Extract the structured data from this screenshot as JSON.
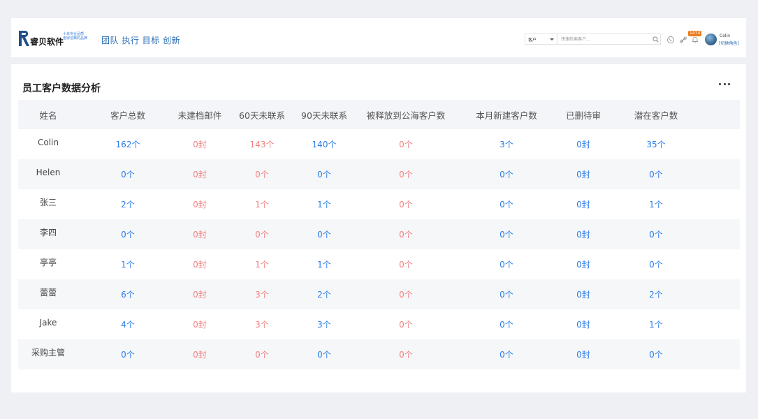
{
  "header": {
    "logo_name": "睿贝软件",
    "logo_tagline_1": "十年专业品质",
    "logo_tagline_2": "值得信赖的品牌",
    "slogan": "团队 执行 目标 创新",
    "search": {
      "type_label": "客户",
      "placeholder": "快速检索客户..."
    },
    "notification_count": "1474",
    "user": {
      "name": "Colin",
      "switch_role": "[切换角色]"
    }
  },
  "panel": {
    "title": "员工客户数据分析",
    "columns": [
      "姓名",
      "客户总数",
      "未建档邮件",
      "60天未联系",
      "90天未联系",
      "被释放到公海客户数",
      "本月新建客户数",
      "已删待审",
      "潜在客户数"
    ],
    "rows": [
      [
        "Colin",
        "162个",
        "0封",
        "143个",
        "140个",
        "0个",
        "3个",
        "0封",
        "35个"
      ],
      [
        "Helen",
        "0个",
        "0封",
        "0个",
        "0个",
        "0个",
        "0个",
        "0封",
        "0个"
      ],
      [
        "张三",
        "2个",
        "0封",
        "1个",
        "1个",
        "0个",
        "0个",
        "0封",
        "1个"
      ],
      [
        "李四",
        "0个",
        "0封",
        "0个",
        "0个",
        "0个",
        "0个",
        "0封",
        "0个"
      ],
      [
        "亭亭",
        "1个",
        "0封",
        "1个",
        "1个",
        "0个",
        "0个",
        "0封",
        "0个"
      ],
      [
        "蕾蕾",
        "6个",
        "0封",
        "3个",
        "2个",
        "0个",
        "0个",
        "0封",
        "2个"
      ],
      [
        "Jake",
        "4个",
        "0封",
        "3个",
        "3个",
        "0个",
        "0个",
        "0封",
        "1个"
      ],
      [
        "采购主管",
        "0个",
        "0封",
        "0个",
        "0个",
        "0个",
        "0个",
        "0封",
        "0个"
      ]
    ]
  },
  "colors": {
    "link_blue": "#2b7de9",
    "warn_red": "#f27f7f",
    "badge_orange": "#ee7a1a"
  }
}
